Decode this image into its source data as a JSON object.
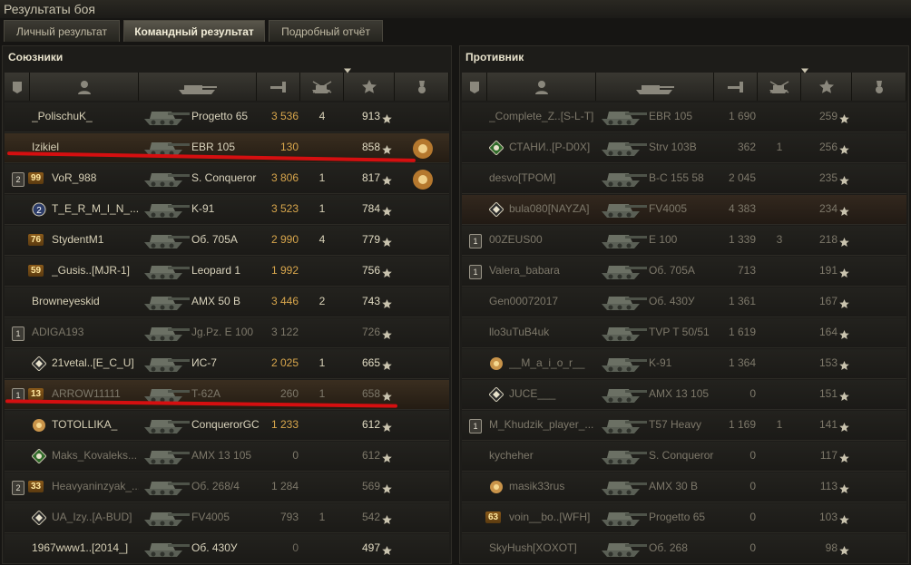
{
  "window": {
    "title": "Результаты боя"
  },
  "tabs": [
    {
      "label": "Личный результат",
      "active": false
    },
    {
      "label": "Командный результат",
      "active": true
    },
    {
      "label": "Подробный отчёт",
      "active": false
    }
  ],
  "colors": {
    "damage": "#d8a64c",
    "accent_red": "#d50f10",
    "badge": "#8a5a1a"
  },
  "allies": {
    "title": "Союзники",
    "rows": [
      {
        "name": "_PolischuK_",
        "vehicle": "Progetto 65",
        "damage": "3 536",
        "kills": "4",
        "xp": "913",
        "platoon": "",
        "badge": "",
        "emblem": "",
        "medal": "",
        "dead": false
      },
      {
        "name": "Izikiel",
        "vehicle": "EBR 105",
        "damage": "130",
        "kills": "",
        "xp": "858",
        "platoon": "",
        "badge": "",
        "emblem": "",
        "medal": "order-2",
        "dead": false,
        "highlight": true
      },
      {
        "name": "VoR_988",
        "vehicle": "S. Conqueror",
        "damage": "3 806",
        "kills": "1",
        "xp": "817",
        "platoon": "2",
        "badge": "99",
        "emblem": "",
        "medal": "order",
        "dead": false
      },
      {
        "name": "T_E_R_M_I_N_...",
        "vehicle": "K-91",
        "damage": "3 523",
        "kills": "1",
        "xp": "784",
        "platoon": "",
        "badge": "",
        "emblem": "rank2",
        "medal": "",
        "dead": false
      },
      {
        "name": "StydentM1",
        "vehicle": "Об. 705А",
        "damage": "2 990",
        "kills": "4",
        "xp": "779",
        "platoon": "",
        "badge": "76",
        "emblem": "",
        "medal": "",
        "dead": false
      },
      {
        "name": "_Gusis..[MJR-1]",
        "vehicle": "Leopard 1",
        "damage": "1 992",
        "kills": "",
        "xp": "756",
        "platoon": "",
        "badge": "59",
        "emblem": "",
        "medal": "",
        "dead": false
      },
      {
        "name": "Browneyeskid",
        "vehicle": "AMX 50 B",
        "damage": "3 446",
        "kills": "2",
        "xp": "743",
        "platoon": "",
        "badge": "",
        "emblem": "",
        "medal": "",
        "dead": false
      },
      {
        "name": "ADIGA193",
        "vehicle": "Jg.Pz. E 100",
        "damage": "3 122",
        "kills": "",
        "xp": "726",
        "platoon": "1",
        "badge": "",
        "emblem": "",
        "medal": "",
        "dead": true
      },
      {
        "name": "21vetal..[E_C_U]",
        "vehicle": "ИС-7",
        "damage": "2 025",
        "kills": "1",
        "xp": "665",
        "platoon": "",
        "badge": "",
        "emblem": "diamond",
        "medal": "",
        "dead": false
      },
      {
        "name": "ARROW11111",
        "vehicle": "T-62A",
        "damage": "260",
        "kills": "1",
        "xp": "658",
        "platoon": "1",
        "badge": "13",
        "emblem": "",
        "medal": "",
        "dead": true,
        "highlight": true
      },
      {
        "name": "TOTOLLIKA_",
        "vehicle": "ConquerorGC",
        "damage": "1 233",
        "kills": "",
        "xp": "612",
        "platoon": "",
        "badge": "",
        "emblem": "sun",
        "medal": "",
        "dead": false
      },
      {
        "name": "Maks_Kovaleks...",
        "vehicle": "AMX 13 105",
        "damage": "0",
        "kills": "",
        "xp": "612",
        "platoon": "",
        "badge": "",
        "emblem": "green",
        "medal": "",
        "dead": true
      },
      {
        "name": "Heavyaninzyak_...",
        "vehicle": "Об. 268/4",
        "damage": "1 284",
        "kills": "",
        "xp": "569",
        "platoon": "2",
        "badge": "33",
        "emblem": "",
        "medal": "",
        "dead": true
      },
      {
        "name": "UA_Izy..[A-BUD]",
        "vehicle": "FV4005",
        "damage": "793",
        "kills": "1",
        "xp": "542",
        "platoon": "",
        "badge": "",
        "emblem": "diamond",
        "medal": "",
        "dead": true
      },
      {
        "name": "1967www1..[2014_]",
        "vehicle": "Об. 430У",
        "damage": "0",
        "kills": "",
        "xp": "497",
        "platoon": "",
        "badge": "",
        "emblem": "",
        "medal": "",
        "dead": false
      }
    ]
  },
  "enemies": {
    "title": "Противник",
    "rows": [
      {
        "name": "_Complete_Z..[S-L-T]",
        "vehicle": "EBR 105",
        "damage": "1 690",
        "kills": "",
        "xp": "259",
        "platoon": "",
        "badge": "",
        "emblem": "",
        "dead": true
      },
      {
        "name": "СТАНИ..[P-D0X]",
        "vehicle": "Strv 103B",
        "damage": "362",
        "kills": "1",
        "xp": "256",
        "platoon": "",
        "badge": "",
        "emblem": "green",
        "dead": true
      },
      {
        "name": "desvo[TPOM]",
        "vehicle": "B-C 155 58",
        "damage": "2 045",
        "kills": "",
        "xp": "235",
        "platoon": "",
        "badge": "",
        "emblem": "",
        "dead": true
      },
      {
        "name": "bula080[NAYZA]",
        "vehicle": "FV4005",
        "damage": "4 383",
        "kills": "",
        "xp": "234",
        "platoon": "",
        "badge": "",
        "emblem": "diamond",
        "dead": true,
        "highlight": true
      },
      {
        "name": "00ZEUS00",
        "vehicle": "E 100",
        "damage": "1 339",
        "kills": "3",
        "xp": "218",
        "platoon": "1",
        "badge": "",
        "emblem": "",
        "dead": true
      },
      {
        "name": "Valera_babara",
        "vehicle": "Об. 705А",
        "damage": "713",
        "kills": "",
        "xp": "191",
        "platoon": "1",
        "badge": "",
        "emblem": "",
        "dead": true
      },
      {
        "name": "Gen00072017",
        "vehicle": "Об. 430У",
        "damage": "1 361",
        "kills": "",
        "xp": "167",
        "platoon": "",
        "badge": "",
        "emblem": "",
        "dead": true
      },
      {
        "name": "llo3uTuB4uk",
        "vehicle": "TVP T 50/51",
        "damage": "1 619",
        "kills": "",
        "xp": "164",
        "platoon": "",
        "badge": "",
        "emblem": "",
        "dead": true
      },
      {
        "name": "__M_a_i_o_r__",
        "vehicle": "K-91",
        "damage": "1 364",
        "kills": "",
        "xp": "153",
        "platoon": "",
        "badge": "",
        "emblem": "sun",
        "dead": true
      },
      {
        "name": "JUCE___",
        "vehicle": "AMX 13 105",
        "damage": "0",
        "kills": "",
        "xp": "151",
        "platoon": "",
        "badge": "",
        "emblem": "diamond",
        "dead": true
      },
      {
        "name": "M_Khudzik_player_...",
        "vehicle": "T57 Heavy",
        "damage": "1 169",
        "kills": "1",
        "xp": "141",
        "platoon": "1",
        "badge": "",
        "emblem": "",
        "dead": true
      },
      {
        "name": "kycheher",
        "vehicle": "S. Conqueror",
        "damage": "0",
        "kills": "",
        "xp": "117",
        "platoon": "",
        "badge": "",
        "emblem": "",
        "dead": true
      },
      {
        "name": "masik33rus",
        "vehicle": "AMX 30 B",
        "damage": "0",
        "kills": "",
        "xp": "113",
        "platoon": "",
        "badge": "",
        "emblem": "sun",
        "dead": true
      },
      {
        "name": "voin__bo..[WFH]",
        "vehicle": "Progetto 65",
        "damage": "0",
        "kills": "",
        "xp": "103",
        "platoon": "",
        "badge": "63",
        "emblem": "",
        "dead": true
      },
      {
        "name": "SkyHush[XOXOT]",
        "vehicle": "Об. 268",
        "damage": "0",
        "kills": "",
        "xp": "98",
        "platoon": "",
        "badge": "",
        "emblem": "",
        "dead": true
      }
    ]
  }
}
